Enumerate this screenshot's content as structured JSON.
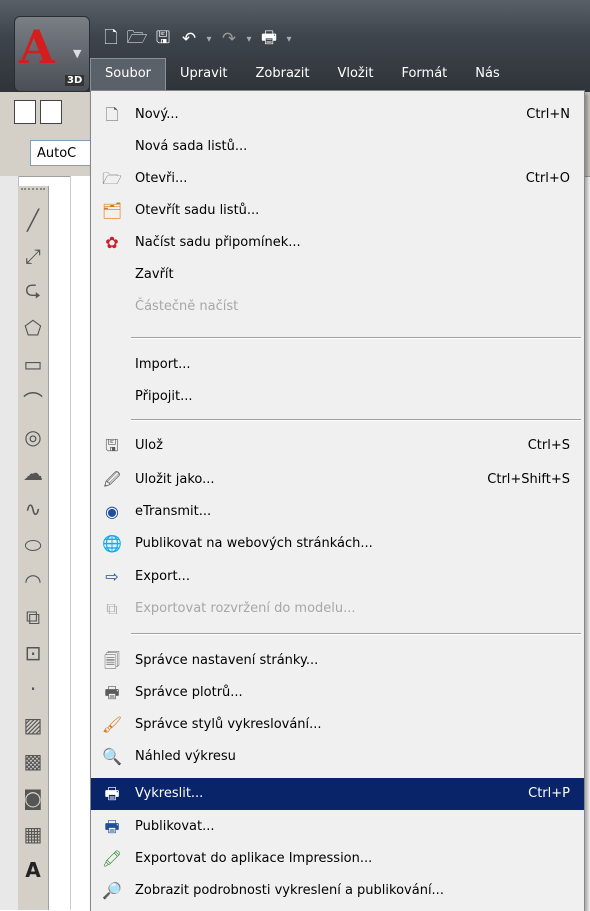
{
  "app": {
    "logo_letter": "A",
    "badge": "3D"
  },
  "quick_access": {
    "icons": [
      "new-icon",
      "open-icon",
      "save-icon",
      "undo-icon",
      "redo-icon",
      "plot-icon",
      "dropdown-icon"
    ]
  },
  "menubar": {
    "items": [
      "Soubor",
      "Upravit",
      "Zobrazit",
      "Vložit",
      "Formát",
      "Nás"
    ]
  },
  "toolbar": {
    "workspace_value": "AutoC"
  },
  "file_menu": {
    "items": [
      {
        "label": "Nový...",
        "shortcut": "Ctrl+N",
        "icon": "new-document-icon"
      },
      {
        "label": "Nová sada listů...",
        "shortcut": "",
        "icon": ""
      },
      {
        "label": "Otevři...",
        "shortcut": "Ctrl+O",
        "icon": "open-folder-icon"
      },
      {
        "label": "Otevřít sadu listů...",
        "shortcut": "",
        "icon": "open-sheet-set-icon"
      },
      {
        "label": "Načíst sadu připomínek...",
        "shortcut": "",
        "icon": "load-markup-icon"
      },
      {
        "label": "Zavřít",
        "shortcut": "",
        "icon": ""
      },
      {
        "label": "Částečně načíst",
        "shortcut": "",
        "icon": "",
        "disabled": true
      },
      {
        "label": "Import...",
        "shortcut": "",
        "icon": ""
      },
      {
        "label": "Připojit...",
        "shortcut": "",
        "icon": ""
      },
      {
        "label": "Ulož",
        "shortcut": "Ctrl+S",
        "icon": "save-icon"
      },
      {
        "label": "Uložit jako...",
        "shortcut": "Ctrl+Shift+S",
        "icon": "save-as-icon"
      },
      {
        "label": "eTransmit...",
        "shortcut": "",
        "icon": "etransmit-icon"
      },
      {
        "label": "Publikovat na webových stránkách...",
        "shortcut": "",
        "icon": "publish-web-icon"
      },
      {
        "label": "Export...",
        "shortcut": "",
        "icon": "export-icon"
      },
      {
        "label": "Exportovat rozvržení do modelu...",
        "shortcut": "",
        "icon": "export-layout-icon",
        "disabled": true
      },
      {
        "label": "Správce nastavení stránky...",
        "shortcut": "",
        "icon": "page-setup-icon"
      },
      {
        "label": "Správce plotrů...",
        "shortcut": "",
        "icon": "plotter-manager-icon"
      },
      {
        "label": "Správce stylů vykreslování...",
        "shortcut": "",
        "icon": "plot-style-icon"
      },
      {
        "label": "Náhled výkresu",
        "shortcut": "",
        "icon": "plot-preview-icon"
      },
      {
        "label": "Vykreslit...",
        "shortcut": "Ctrl+P",
        "icon": "plot-printer-icon",
        "highlighted": true
      },
      {
        "label": "Publikovat...",
        "shortcut": "",
        "icon": "publish-icon"
      },
      {
        "label": "Exportovat do aplikace Impression...",
        "shortcut": "",
        "icon": "impression-icon"
      },
      {
        "label": "Zobrazit podrobnosti vykreslení a publikování...",
        "shortcut": "",
        "icon": "plot-details-icon"
      }
    ]
  },
  "colors": {
    "highlight": "#0a246a",
    "menu_bg": "#f0f0f0",
    "titlebar": "#3e444b",
    "disabled_text": "#a7a7a7"
  }
}
